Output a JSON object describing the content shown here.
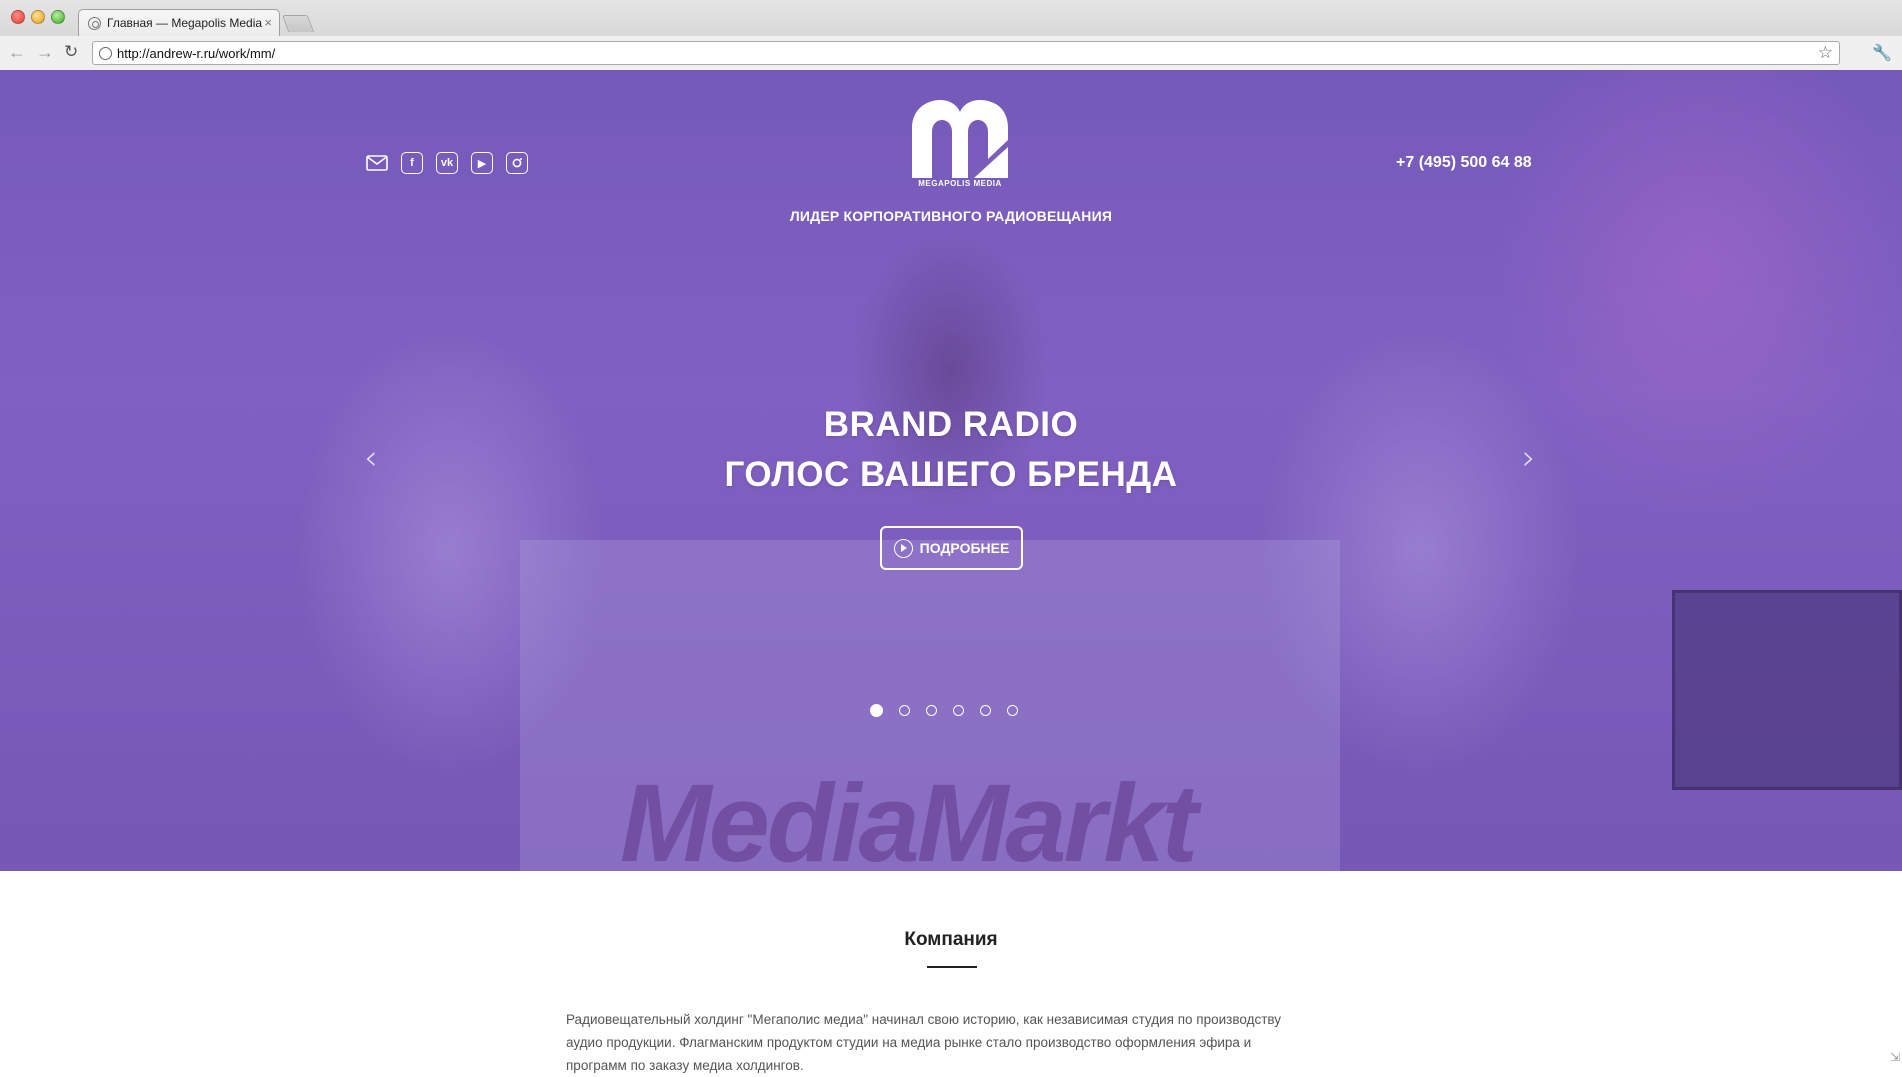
{
  "browser": {
    "tab_title": "Главная — Megapolis Media",
    "tab_close": "×",
    "url": "http://andrew-r.ru/work/mm/",
    "icons": [
      "back-icon",
      "forward-icon",
      "reload-icon",
      "star-icon",
      "wrench-icon"
    ]
  },
  "header": {
    "social": [
      "mail-icon",
      "facebook-icon",
      "vk-icon",
      "youtube-icon",
      "instagram-icon"
    ],
    "vk_label": "vk",
    "logo_caption": "MEGAPOLIS MEDIA",
    "tagline": "ЛИДЕР КОРПОРАТИВНОГО РАДИОВЕЩАНИЯ",
    "phone": "+7 (495) 500 64 88"
  },
  "slider": {
    "headline_line1": "BRAND RADIO",
    "headline_line2": "ГОЛОС ВАШЕГО БРЕНДА",
    "button_label": "ПОДРОБНЕЕ",
    "prev": "‹",
    "next": "›",
    "slide_count": 6,
    "active_slide": 1,
    "background_logo": "MediaMarkt"
  },
  "company": {
    "title": "Компания",
    "text": "Радиовещательный холдинг \"Мегаполис медиа\" начинал свою историю, как независимая студия по производству аудио продукции. Флагманским продуктом студии на медиа рынке стало производство оформления эфира и программ по заказу медиа холдингов."
  },
  "colors": {
    "hero_overlay": "#7a5fb8",
    "text_light": "#ffffff",
    "heading_dark": "#222222",
    "body_text": "#555555"
  }
}
